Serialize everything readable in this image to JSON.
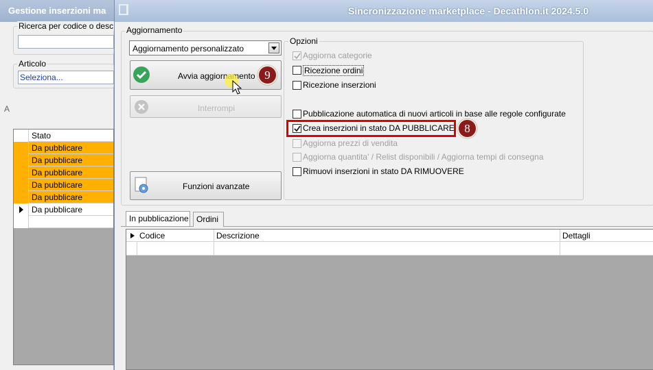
{
  "background_window": {
    "title": "Gestione inserzioni ma",
    "search_label": "Ricerca per codice o desc",
    "article_label": "Articolo",
    "article_value": "Seleziona...",
    "grid_header": "Stato",
    "grid_rows": [
      "Da pubblicare",
      "Da pubblicare",
      "Da pubblicare",
      "Da pubblicare",
      "Da pubblicare",
      "Da pubblicare"
    ],
    "side_glyph": "A"
  },
  "main_window": {
    "title": "Sincronizzazione marketplace - Decathlon.it 2024.5.0"
  },
  "aggiornamento": {
    "group_label": "Aggiornamento",
    "dropdown_value": "Aggiornamento personalizzato",
    "start_button": "Avvia aggiornamento",
    "stop_button": "Interrompi",
    "advanced_button": "Funzioni avanzate"
  },
  "opzioni": {
    "group_label": "Opzioni",
    "options": [
      {
        "label": "Aggiorna categorie",
        "checked": true,
        "enabled": false
      },
      {
        "label": "Ricezione ordini",
        "checked": false,
        "enabled": true
      },
      {
        "label": "Ricezione inserzioni",
        "checked": false,
        "enabled": true
      },
      {
        "label": "Pubblicazione automatica di nuovi articoli in base alle regole configurate",
        "checked": false,
        "enabled": true
      },
      {
        "label": "Crea inserzioni in stato DA PUBBLICARE",
        "checked": true,
        "enabled": true
      },
      {
        "label": "Aggiorna prezzi di vendita",
        "checked": false,
        "enabled": false
      },
      {
        "label": "Aggiorna quantita' / Relist disponibili / Aggiorna tempi di consegna",
        "checked": false,
        "enabled": false
      },
      {
        "label": "Rimuovi inserzioni in stato DA RIMUOVERE",
        "checked": false,
        "enabled": true
      }
    ]
  },
  "annotations": {
    "badge_start": "9",
    "badge_option": "8"
  },
  "tabs": [
    "In pubblicazione",
    "Ordini"
  ],
  "grid_columns": [
    "Codice",
    "Descrizione",
    "Dettagli"
  ],
  "colors": {
    "row_highlight": "#ffb000",
    "highlight_box": "#e00000",
    "badge": "#8b1a1a",
    "ok_icon": "#3aa35a"
  }
}
